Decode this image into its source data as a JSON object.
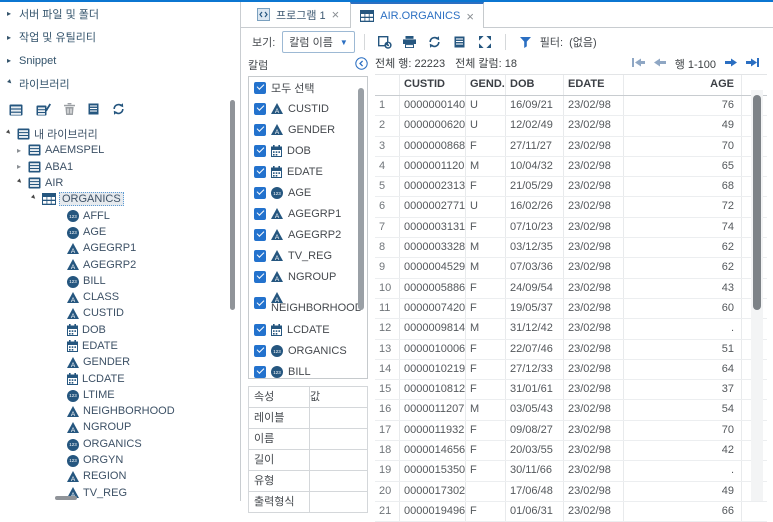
{
  "accent_color": "#0b76d1",
  "icon_color": "#25567f",
  "checkbox_color": "#2372cd",
  "sidebar": {
    "nav_items": [
      {
        "label": "서버 파일 및 폴더",
        "expanded": false
      },
      {
        "label": "작업 및 유틸리티",
        "expanded": false
      },
      {
        "label": "Snippet",
        "expanded": false
      },
      {
        "label": "라이브러리",
        "expanded": true
      }
    ],
    "library_toolbar_icons": [
      "new-library",
      "assign-library",
      "delete",
      "table-properties",
      "refresh"
    ],
    "tree": [
      {
        "label": "내 라이브러리",
        "icon": "library",
        "level": 0,
        "state": "expanded"
      },
      {
        "label": "AAEMSPEL",
        "icon": "library",
        "level": 1,
        "state": "collapsed"
      },
      {
        "label": "ABA1",
        "icon": "library",
        "level": 1,
        "state": "collapsed"
      },
      {
        "label": "AIR",
        "icon": "library",
        "level": 1,
        "state": "expanded"
      },
      {
        "label": "ORGANICS",
        "icon": "table",
        "level": 2,
        "state": "expanded",
        "selected": true
      },
      {
        "label": "AFFL",
        "icon": "numeric",
        "level": 3
      },
      {
        "label": "AGE",
        "icon": "numeric",
        "level": 3
      },
      {
        "label": "AGEGRP1",
        "icon": "character",
        "level": 3
      },
      {
        "label": "AGEGRP2",
        "icon": "character",
        "level": 3
      },
      {
        "label": "BILL",
        "icon": "numeric",
        "level": 3
      },
      {
        "label": "CLASS",
        "icon": "character",
        "level": 3
      },
      {
        "label": "CUSTID",
        "icon": "character",
        "level": 3
      },
      {
        "label": "DOB",
        "icon": "date",
        "level": 3
      },
      {
        "label": "EDATE",
        "icon": "date",
        "level": 3
      },
      {
        "label": "GENDER",
        "icon": "character",
        "level": 3
      },
      {
        "label": "LCDATE",
        "icon": "date",
        "level": 3
      },
      {
        "label": "LTIME",
        "icon": "numeric",
        "level": 3
      },
      {
        "label": "NEIGHBORHOOD",
        "icon": "character",
        "level": 3
      },
      {
        "label": "NGROUP",
        "icon": "character",
        "level": 3
      },
      {
        "label": "ORGANICS",
        "icon": "numeric",
        "level": 3
      },
      {
        "label": "ORGYN",
        "icon": "numeric",
        "level": 3
      },
      {
        "label": "REGION",
        "icon": "character",
        "level": 3
      },
      {
        "label": "TV_REG",
        "icon": "character",
        "level": 3
      }
    ]
  },
  "tabs": [
    {
      "label": "프로그램 1",
      "icon": "program",
      "active": false
    },
    {
      "label": "AIR.ORGANICS",
      "icon": "table",
      "active": true
    }
  ],
  "toolbar": {
    "view_label": "보기:",
    "view_value": "칼럼 이름",
    "icons": [
      "export",
      "print",
      "refresh",
      "properties",
      "maximize"
    ],
    "filter_label": "필터:",
    "filter_value": "(없음)"
  },
  "columns_panel": {
    "title": "칼럼",
    "items": [
      {
        "label": "모두 선택",
        "icon": null,
        "checked": true
      },
      {
        "label": "CUSTID",
        "icon": "character",
        "checked": true
      },
      {
        "label": "GENDER",
        "icon": "character",
        "checked": true
      },
      {
        "label": "DOB",
        "icon": "date",
        "checked": true
      },
      {
        "label": "EDATE",
        "icon": "date",
        "checked": true
      },
      {
        "label": "AGE",
        "icon": "numeric",
        "checked": true
      },
      {
        "label": "AGEGRP1",
        "icon": "character",
        "checked": true
      },
      {
        "label": "AGEGRP2",
        "icon": "character",
        "checked": true
      },
      {
        "label": "TV_REG",
        "icon": "character",
        "checked": true
      },
      {
        "label": "NGROUP",
        "icon": "character",
        "checked": true
      },
      {
        "label": "NEIGHBORHOOD",
        "icon": "character",
        "checked": true,
        "wrap": true
      },
      {
        "label": "LCDATE",
        "icon": "date",
        "checked": true
      },
      {
        "label": "ORGANICS",
        "icon": "numeric",
        "checked": true
      },
      {
        "label": "BILL",
        "icon": "numeric",
        "checked": true
      }
    ]
  },
  "properties_panel": {
    "attribute_header": "속성",
    "value_header": "값",
    "rows": [
      {
        "label": "레이블",
        "value": ""
      },
      {
        "label": "이름",
        "value": ""
      },
      {
        "label": "길이",
        "value": ""
      },
      {
        "label": "유형",
        "value": ""
      },
      {
        "label": "출력형식",
        "value": ""
      }
    ]
  },
  "grid": {
    "total_rows_label": "전체 행: 22223",
    "total_cols_label": "전체 칼럼: 18",
    "pager_label": "행 1-100",
    "columns": [
      "CUSTID",
      "GEND...",
      "DOB",
      "EDATE",
      "AGE"
    ],
    "rows": [
      [
        "0000000140",
        "U",
        "16/09/21",
        "23/02/98",
        "76"
      ],
      [
        "0000000620",
        "U",
        "12/02/49",
        "23/02/98",
        "49"
      ],
      [
        "0000000868",
        "F",
        "27/11/27",
        "23/02/98",
        "70"
      ],
      [
        "0000001120",
        "M",
        "10/04/32",
        "23/02/98",
        "65"
      ],
      [
        "0000002313",
        "F",
        "21/05/29",
        "23/02/98",
        "68"
      ],
      [
        "0000002771",
        "U",
        "16/02/26",
        "23/02/98",
        "72"
      ],
      [
        "0000003131",
        "F",
        "07/10/23",
        "23/02/98",
        "74"
      ],
      [
        "0000003328",
        "M",
        "03/12/35",
        "23/02/98",
        "62"
      ],
      [
        "0000004529",
        "M",
        "07/03/36",
        "23/02/98",
        "62"
      ],
      [
        "0000005886",
        "F",
        "24/09/54",
        "23/02/98",
        "43"
      ],
      [
        "0000007420",
        "F",
        "19/05/37",
        "23/02/98",
        "60"
      ],
      [
        "0000009814",
        "M",
        "31/12/42",
        "23/02/98",
        "."
      ],
      [
        "0000010006",
        "F",
        "22/07/46",
        "23/02/98",
        "51"
      ],
      [
        "0000010219",
        "F",
        "27/12/33",
        "23/02/98",
        "64"
      ],
      [
        "0000010812",
        "F",
        "31/01/61",
        "23/02/98",
        "37"
      ],
      [
        "0000011207",
        "M",
        "03/05/43",
        "23/02/98",
        "54"
      ],
      [
        "0000011932",
        "F",
        "09/08/27",
        "23/02/98",
        "70"
      ],
      [
        "0000014656",
        "F",
        "20/03/55",
        "23/02/98",
        "42"
      ],
      [
        "0000015350",
        "F",
        "30/11/66",
        "23/02/98",
        "."
      ],
      [
        "0000017302",
        "",
        "17/06/48",
        "23/02/98",
        "49"
      ],
      [
        "0000019496",
        "F",
        "01/06/31",
        "23/02/98",
        "66"
      ]
    ]
  }
}
